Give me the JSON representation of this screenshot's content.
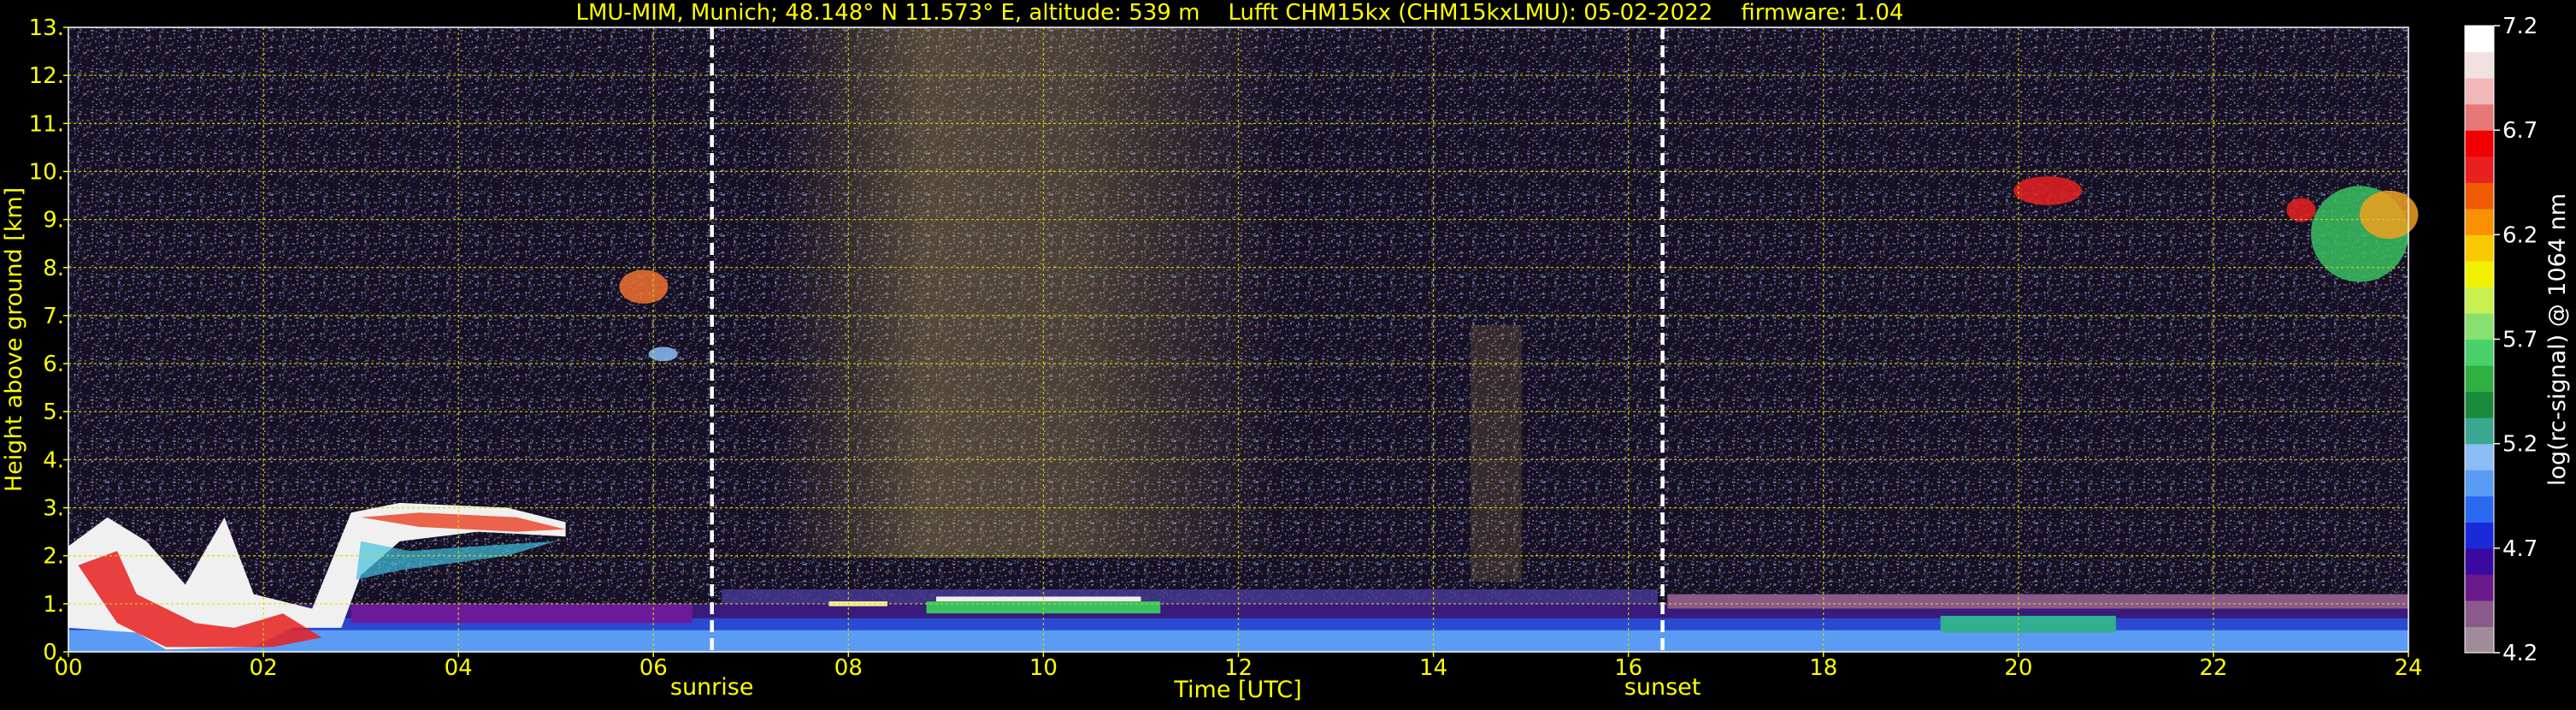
{
  "chart_data": {
    "type": "heatmap",
    "title": "LMU-MIM, Munich; 48.148° N 11.573° E, altitude: 539 m    Lufft CHM15kx (CHM15kxLMU): 05-02-2022    firmware: 1.04",
    "xlabel": "Time [UTC]",
    "ylabel": "Height above ground [km]",
    "xlim": [
      0,
      24
    ],
    "ylim": [
      0,
      13
    ],
    "x_ticks": [
      0,
      2,
      4,
      6,
      8,
      10,
      12,
      14,
      16,
      18,
      20,
      22,
      24
    ],
    "x_tick_labels": [
      "00",
      "02",
      "04",
      "06",
      "08",
      "10",
      "12",
      "14",
      "16",
      "18",
      "20",
      "22",
      "24"
    ],
    "y_ticks": [
      0,
      1,
      2,
      3,
      4,
      5,
      6,
      7,
      8,
      9,
      10,
      11,
      12,
      13
    ],
    "y_tick_labels": [
      "0.",
      "1.",
      "2.",
      "3.",
      "4.",
      "5.",
      "6.",
      "7.",
      "8.",
      "9.",
      "10.",
      "11.",
      "12.",
      "13."
    ],
    "grid": true,
    "markers": [
      {
        "label": "sunrise",
        "x": 6.6
      },
      {
        "label": "sunset",
        "x": 16.35
      }
    ],
    "colorbar": {
      "label": "log(rc-signal) @ 1064 nm",
      "range": [
        4.2,
        7.2
      ],
      "ticks": [
        4.2,
        4.7,
        5.2,
        5.7,
        6.2,
        6.7,
        7.2
      ],
      "tick_labels": [
        "4.2",
        "4.7",
        "5.2",
        "5.7",
        "6.2",
        "6.7",
        "7.2"
      ],
      "colors": [
        "#a08c9a",
        "#8a5a8a",
        "#6a1a8a",
        "#3a0aa0",
        "#1a2ad8",
        "#2a6af0",
        "#5a9cf4",
        "#8cbcf4",
        "#3aa890",
        "#1a8a3a",
        "#30b040",
        "#4ad06a",
        "#88e070",
        "#c8f050",
        "#f0f000",
        "#f8c800",
        "#f89000",
        "#f05a00",
        "#e82020",
        "#f00000",
        "#e87878",
        "#f0b8b8",
        "#f0e0e0",
        "#ffffff"
      ]
    }
  }
}
